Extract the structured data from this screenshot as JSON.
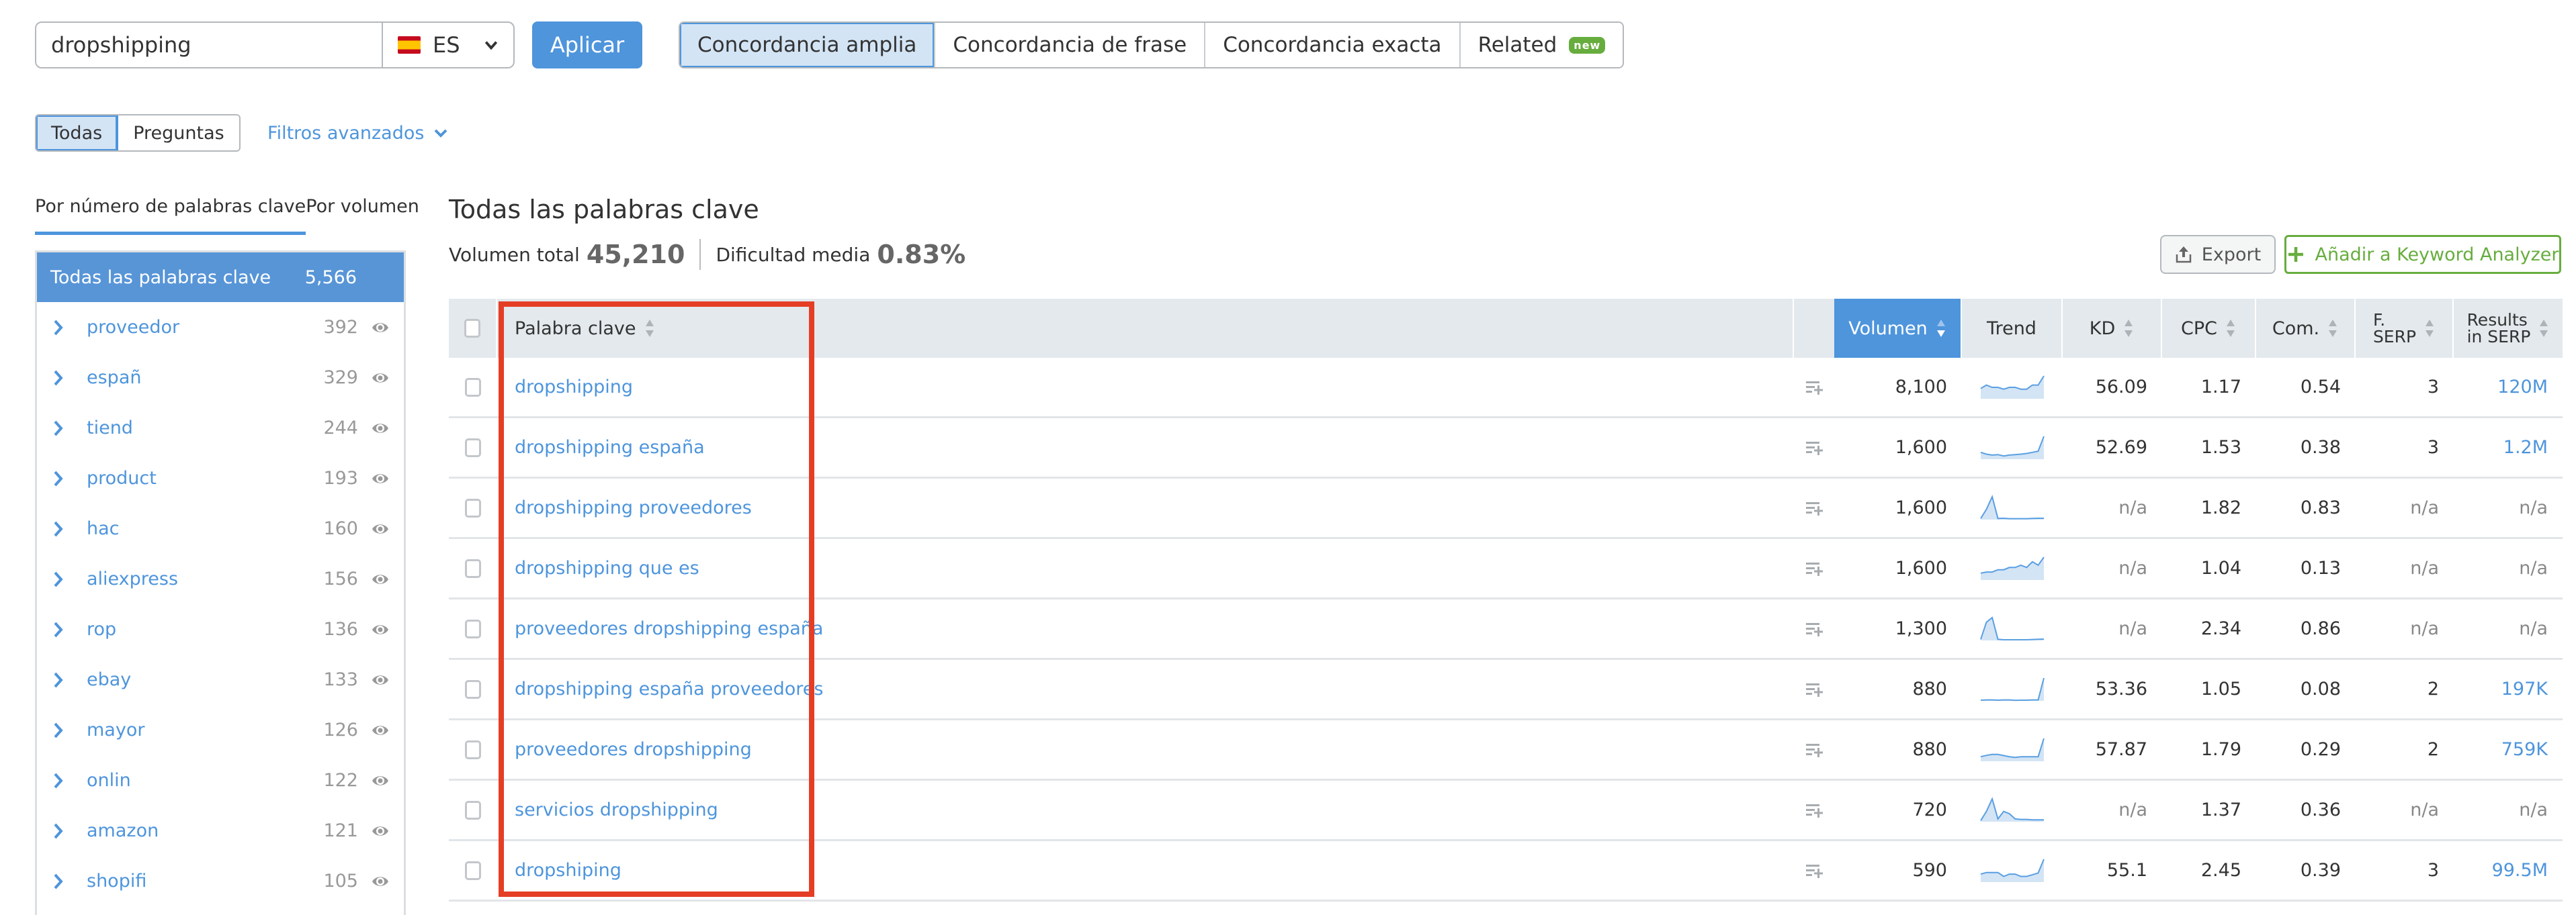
{
  "search": {
    "query": "dropshipping",
    "database_code": "ES",
    "database_flag": "spain-flag-icon",
    "apply_label": "Aplicar"
  },
  "match_tabs": [
    {
      "label": "Concordancia amplia",
      "active": true
    },
    {
      "label": "Concordancia de frase",
      "active": false
    },
    {
      "label": "Concordancia exacta",
      "active": false
    },
    {
      "label": "Related",
      "active": false,
      "badge": "new"
    }
  ],
  "type_tabs": [
    {
      "label": "Todas",
      "active": true
    },
    {
      "label": "Preguntas",
      "active": false
    }
  ],
  "advanced_filters_label": "Filtros avanzados",
  "sidebar": {
    "tabs": [
      {
        "label": "Por número de palabras clave",
        "active": true
      },
      {
        "label": "Por volumen",
        "active": false
      }
    ],
    "all": {
      "label": "Todas las palabras clave",
      "count": "5,566"
    },
    "groups": [
      {
        "label": "proveedor",
        "count": "392"
      },
      {
        "label": "españ",
        "count": "329"
      },
      {
        "label": "tiend",
        "count": "244"
      },
      {
        "label": "product",
        "count": "193"
      },
      {
        "label": "hac",
        "count": "160"
      },
      {
        "label": "aliexpress",
        "count": "156"
      },
      {
        "label": "rop",
        "count": "136"
      },
      {
        "label": "ebay",
        "count": "133"
      },
      {
        "label": "mayor",
        "count": "126"
      },
      {
        "label": "onlin",
        "count": "122"
      },
      {
        "label": "amazon",
        "count": "121"
      },
      {
        "label": "shopifi",
        "count": "105"
      }
    ]
  },
  "main": {
    "title": "Todas las palabras clave",
    "total_volume_label": "Volumen total",
    "total_volume": "45,210",
    "avg_difficulty_label": "Dificultad media",
    "avg_difficulty": "0.83%",
    "export_label": "Export",
    "add_to_analyzer_label": "Añadir a Keyword Analyzer"
  },
  "table": {
    "columns": {
      "keyword": "Palabra clave",
      "volume": "Volumen",
      "trend": "Trend",
      "kd": "KD",
      "cpc": "CPC",
      "com": "Com.",
      "serp_line1": "F.",
      "serp_line2": "SERP",
      "results_line1": "Results",
      "results_line2": "in SERP"
    },
    "sorted_by": "volume",
    "rows": [
      {
        "keyword": "dropshipping",
        "volume": "8,100",
        "trend": [
          0.45,
          0.6,
          0.5,
          0.5,
          0.42,
          0.5,
          0.5,
          0.42,
          0.42,
          0.6,
          0.6,
          1.0
        ],
        "kd": "56.09",
        "cpc": "1.17",
        "com": "0.54",
        "serp": "3",
        "results": "120M"
      },
      {
        "keyword": "dropshipping españa",
        "volume": "1,600",
        "trend": [
          0.3,
          0.22,
          0.18,
          0.2,
          0.14,
          0.18,
          0.2,
          0.22,
          0.25,
          0.3,
          0.35,
          1.0
        ],
        "kd": "52.69",
        "cpc": "1.53",
        "com": "0.38",
        "serp": "3",
        "results": "1.2M"
      },
      {
        "keyword": "dropshipping proveedores",
        "volume": "1,600",
        "trend": [
          0.05,
          0.45,
          1.0,
          0.05,
          0.06,
          0.04,
          0.04,
          0.04,
          0.04,
          0.05,
          0.06,
          0.06
        ],
        "kd": "n/a",
        "cpc": "1.82",
        "com": "0.83",
        "serp": "n/a",
        "results": "n/a"
      },
      {
        "keyword": "dropshipping que es",
        "volume": "1,600",
        "trend": [
          0.3,
          0.35,
          0.35,
          0.45,
          0.45,
          0.55,
          0.55,
          0.65,
          0.55,
          0.8,
          0.65,
          1.0
        ],
        "kd": "n/a",
        "cpc": "1.04",
        "com": "0.13",
        "serp": "n/a",
        "results": "n/a"
      },
      {
        "keyword": "proveedores dropshipping españa",
        "volume": "1,300",
        "trend": [
          0.05,
          0.8,
          1.0,
          0.05,
          0.03,
          0.03,
          0.03,
          0.03,
          0.03,
          0.04,
          0.05,
          0.06
        ],
        "kd": "n/a",
        "cpc": "2.34",
        "com": "0.86",
        "serp": "n/a",
        "results": "n/a"
      },
      {
        "keyword": "dropshipping españa proveedores",
        "volume": "880",
        "trend": [
          0.03,
          0.04,
          0.04,
          0.03,
          0.04,
          0.04,
          0.02,
          0.03,
          0.03,
          0.04,
          0.04,
          1.0
        ],
        "kd": "53.36",
        "cpc": "1.05",
        "com": "0.08",
        "serp": "2",
        "results": "197K"
      },
      {
        "keyword": "proveedores dropshipping",
        "volume": "880",
        "trend": [
          0.2,
          0.26,
          0.3,
          0.3,
          0.25,
          0.2,
          0.17,
          0.2,
          0.2,
          0.2,
          0.2,
          1.0
        ],
        "kd": "57.87",
        "cpc": "1.79",
        "com": "0.29",
        "serp": "2",
        "results": "759K"
      },
      {
        "keyword": "servicios dropshipping",
        "volume": "720",
        "trend": [
          0.05,
          0.45,
          1.0,
          0.12,
          0.45,
          0.35,
          0.12,
          0.1,
          0.1,
          0.08,
          0.08,
          0.08
        ],
        "kd": "n/a",
        "cpc": "1.37",
        "com": "0.36",
        "serp": "n/a",
        "results": "n/a"
      },
      {
        "keyword": "dropshiping",
        "volume": "590",
        "trend": [
          0.35,
          0.42,
          0.42,
          0.42,
          0.25,
          0.35,
          0.35,
          0.25,
          0.25,
          0.32,
          0.4,
          1.0
        ],
        "kd": "55.1",
        "cpc": "2.45",
        "com": "0.39",
        "serp": "3",
        "results": "99.5M"
      }
    ]
  },
  "colors": {
    "accent": "#4e95dc",
    "sidebar_active": "#5895d7",
    "green": "#67ad3e",
    "highlight": "#e53e25",
    "header_bg": "#e3e9ed"
  }
}
